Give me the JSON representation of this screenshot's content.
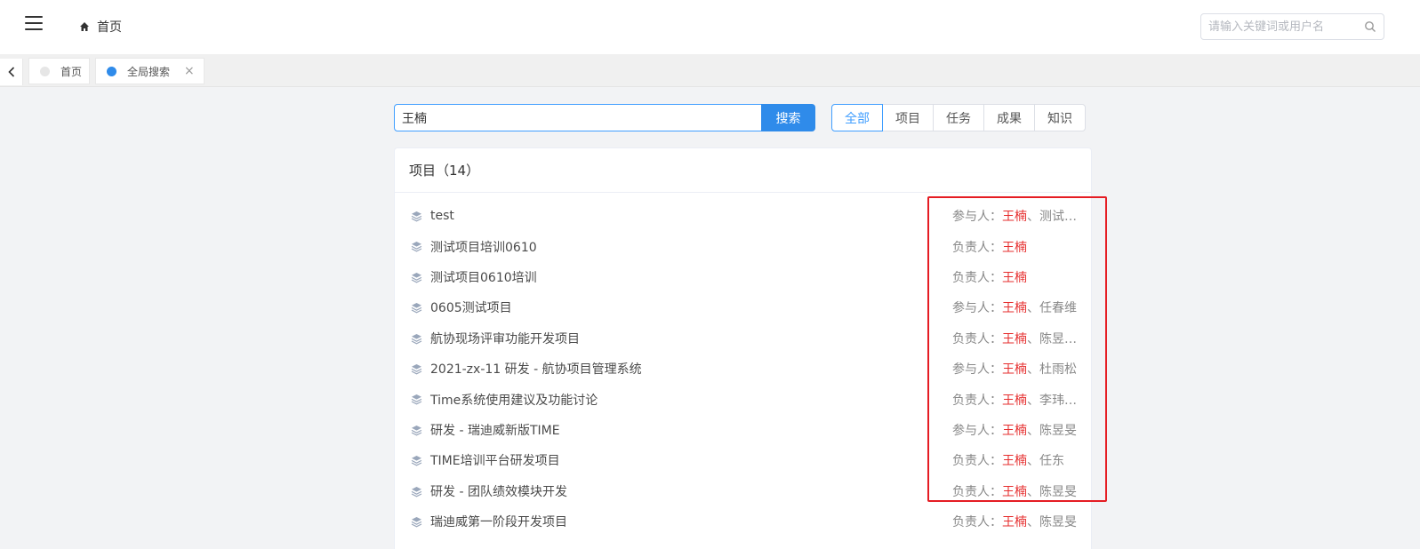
{
  "topbar": {
    "menu_icon": "hamburger-icon",
    "breadcrumb_icon": "home-icon",
    "breadcrumb": "首页",
    "search_placeholder": "请输入关键词或用户名",
    "search_icon": "search-icon"
  },
  "tabs": [
    {
      "label": "首页",
      "dot_color": "#e6e6e6",
      "active": false
    },
    {
      "label": "全局搜索",
      "dot_color": "#2f8bea",
      "active": true,
      "close": "×"
    }
  ],
  "search": {
    "value": "王楠",
    "button": "搜索"
  },
  "filters": [
    "全部",
    "项目",
    "任务",
    "成果",
    "知识"
  ],
  "active_filter": "全部",
  "results": {
    "header": "项目（14）",
    "items": [
      {
        "title": "test",
        "role": "参与人：",
        "highlight": "王楠",
        "others": "、测试…"
      },
      {
        "title": "测试项目培训0610",
        "role": "负责人：",
        "highlight": "王楠",
        "others": ""
      },
      {
        "title": "测试项目0610培训",
        "role": "负责人：",
        "highlight": "王楠",
        "others": ""
      },
      {
        "title": "0605测试项目",
        "role": "参与人：",
        "highlight": "王楠",
        "others": "、任春维"
      },
      {
        "title": "航协现场评审功能开发项目",
        "role": "负责人：",
        "highlight": "王楠",
        "others": "、陈昱…"
      },
      {
        "title": "2021-zx-11 研发 - 航协项目管理系统",
        "role": "参与人：",
        "highlight": "王楠",
        "others": "、杜雨松"
      },
      {
        "title": "Time系统使用建议及功能讨论",
        "role": "负责人：",
        "highlight": "王楠",
        "others": "、李玮…"
      },
      {
        "title": "研发 - 瑞迪威新版TIME",
        "role": "参与人：",
        "highlight": "王楠",
        "others": "、陈昱旻"
      },
      {
        "title": "TIME培训平台研发项目",
        "role": "负责人：",
        "highlight": "王楠",
        "others": "、任东"
      },
      {
        "title": "研发 - 团队绩效模块开发",
        "role": "负责人：",
        "highlight": "王楠",
        "others": "、陈昱旻"
      },
      {
        "title": "瑞迪威第一阶段开发项目",
        "role": "负责人：",
        "highlight": "王楠",
        "others": "、陈昱旻"
      }
    ]
  },
  "colors": {
    "accent": "#409eff",
    "highlight_text": "#e62e2e",
    "annotation_box": "#e51c23"
  }
}
